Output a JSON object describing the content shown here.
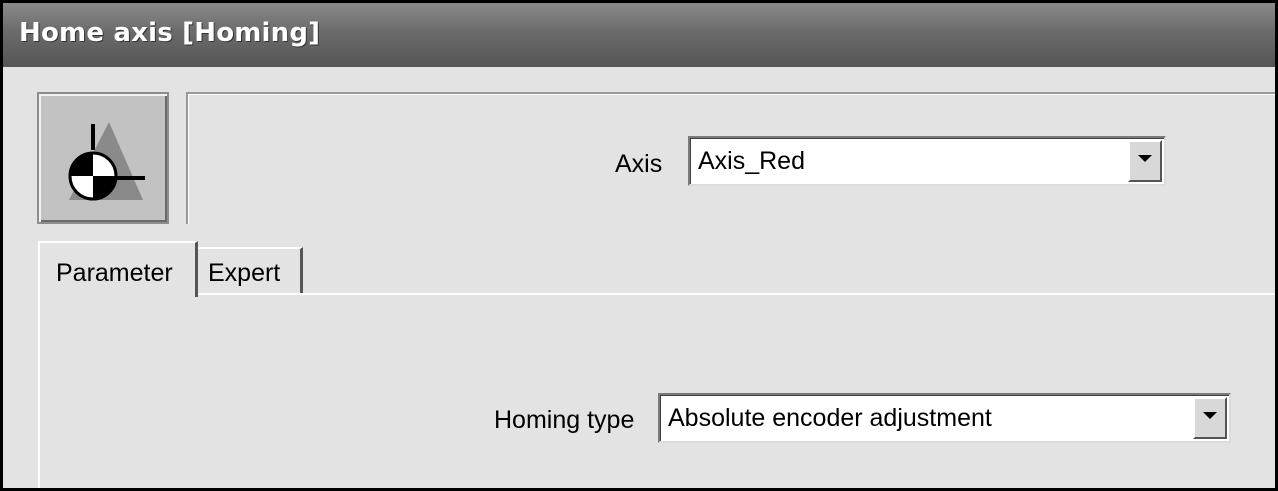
{
  "window": {
    "title": "Home axis [Homing]"
  },
  "header": {
    "icon": "homing-icon",
    "axis_label": "Axis",
    "axis_value": "Axis_Red"
  },
  "tabs": [
    {
      "label": "Parameter",
      "active": true
    },
    {
      "label": "Expert",
      "active": false
    }
  ],
  "parameter": {
    "homing_type_label": "Homing type",
    "homing_type_value": "Absolute encoder adjustment"
  }
}
